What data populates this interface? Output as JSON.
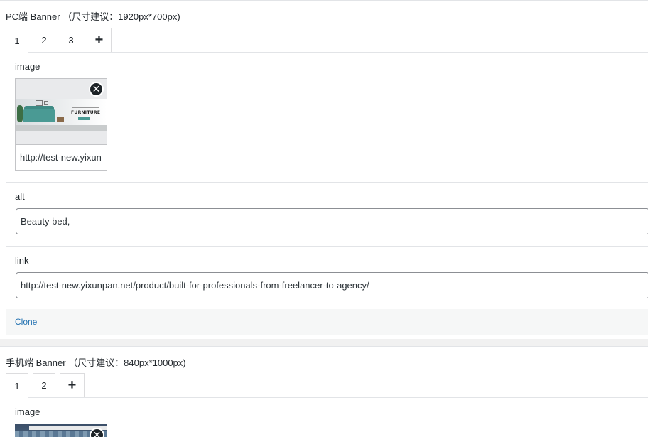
{
  "pc": {
    "title": "PC端 Banner （尺寸建议：1920px*700px)",
    "tabs": [
      "1",
      "2",
      "3"
    ],
    "add_tab": "+",
    "fields": {
      "image_label": "image",
      "image_url": "http://test-new.yixunpan.net",
      "remove_icon": "✕",
      "banner_text": "FURNITURE",
      "alt_label": "alt",
      "alt_value": "Beauty bed,",
      "link_label": "link",
      "link_value": "http://test-new.yixunpan.net/product/built-for-professionals-from-freelancer-to-agency/"
    },
    "clone_label": "Clone"
  },
  "mobile": {
    "title": "手机端 Banner （尺寸建议：840px*1000px)",
    "tabs": [
      "1",
      "2"
    ],
    "add_tab": "+",
    "image_label": "image"
  },
  "icons": {
    "remove": "close-circle-icon",
    "add": "plus-icon"
  },
  "colors": {
    "link": "#2271b1",
    "background": "#f1f1f1",
    "border": "#e2e4e7"
  }
}
